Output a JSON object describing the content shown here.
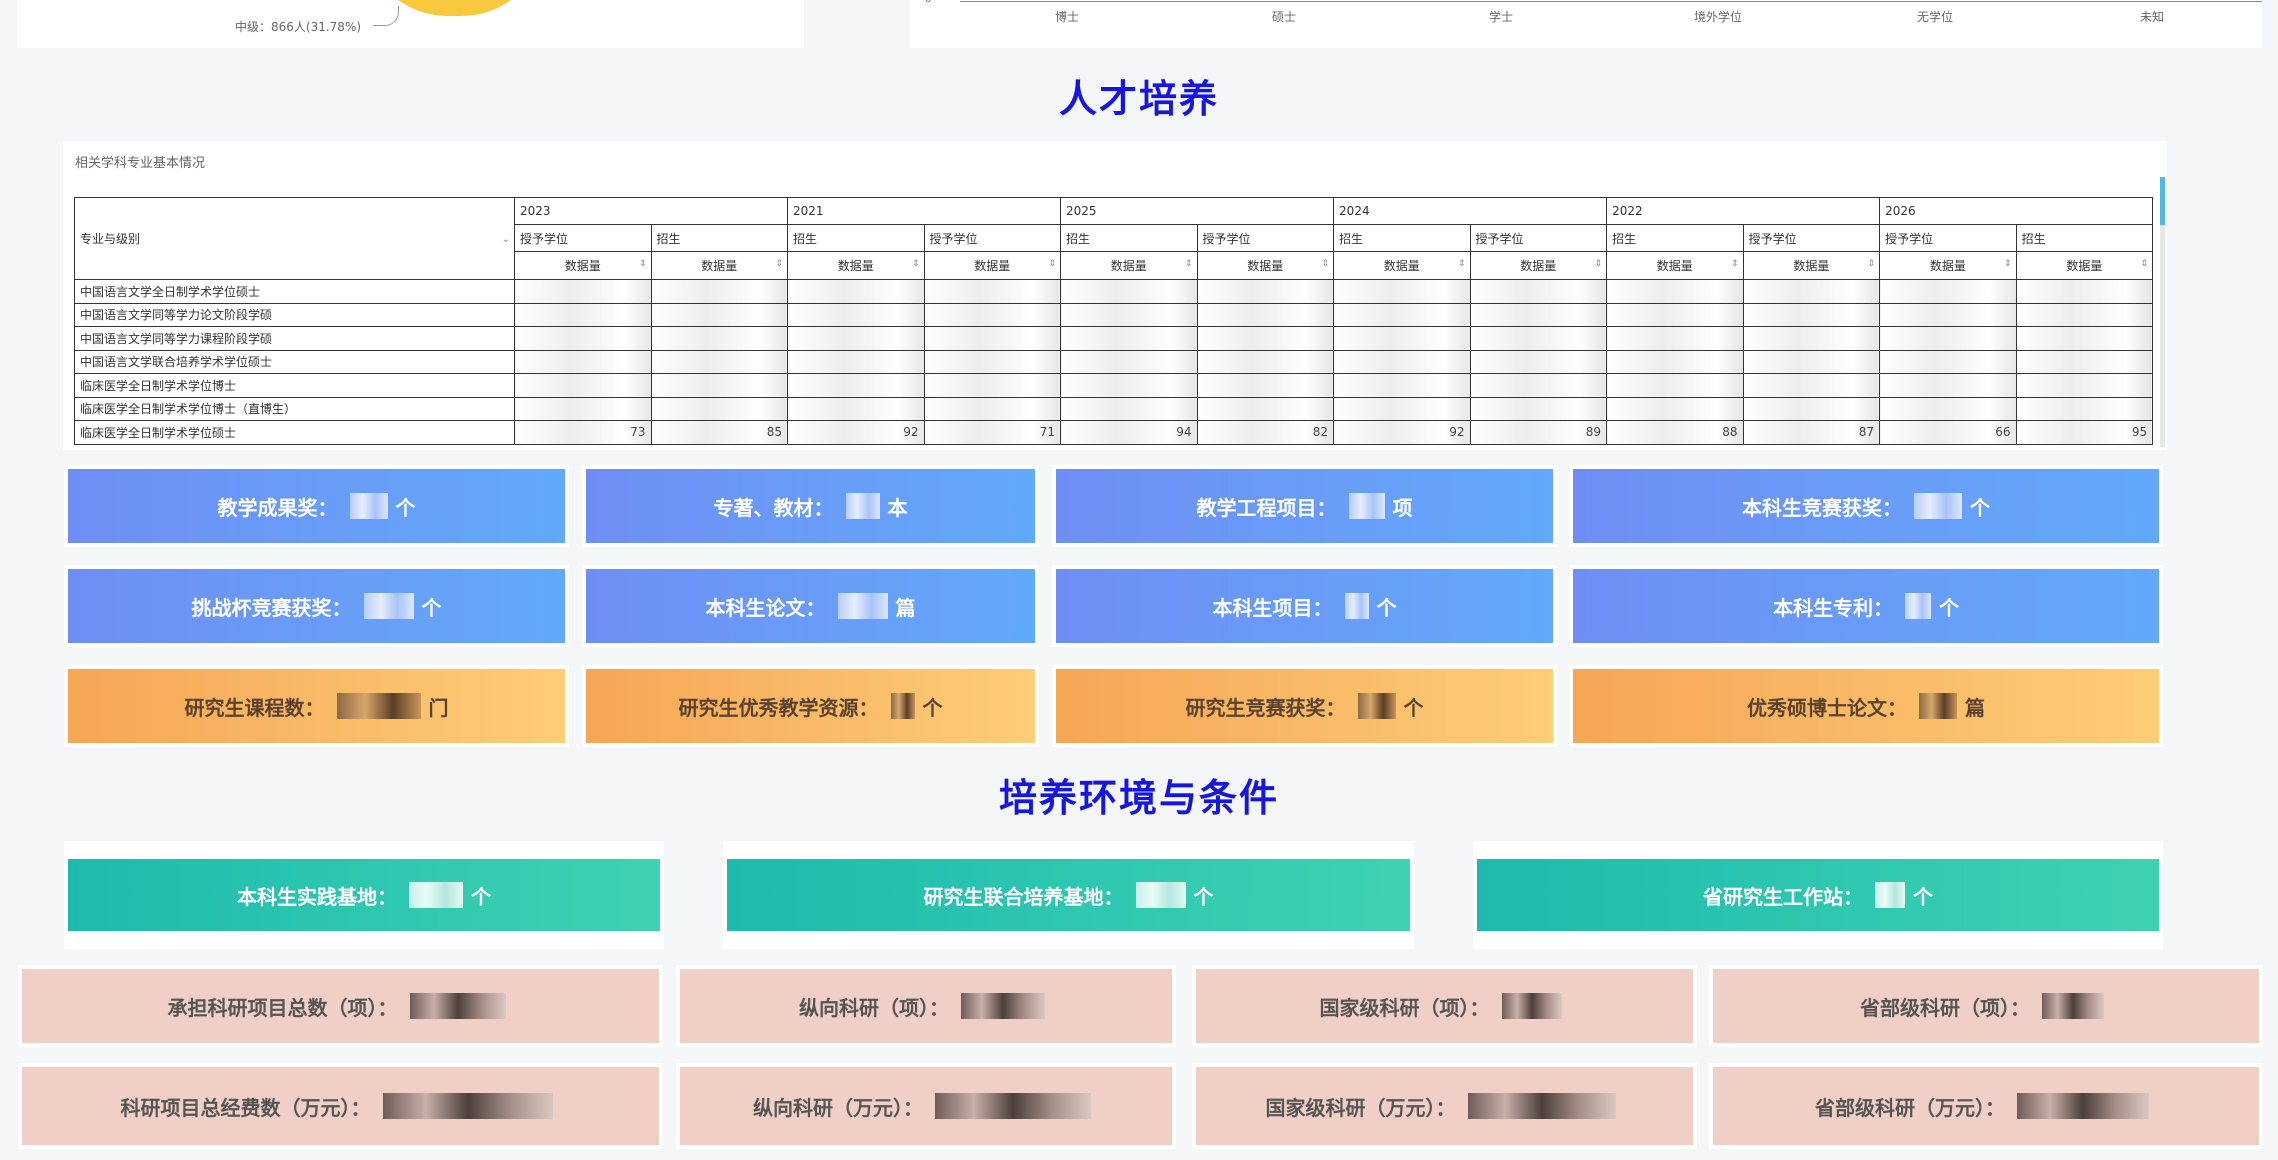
{
  "top_left": {
    "pie_label": "中级：866人(31.78%)"
  },
  "top_right": {
    "axis_zero": "0",
    "categories": [
      "博士",
      "硕士",
      "学士",
      "境外学位",
      "无学位",
      "未知"
    ]
  },
  "section_talent_title": "人才培养",
  "section_env_title": "培养环境与条件",
  "table": {
    "caption": "相关学科专业基本情况",
    "row_header": "专业与级别",
    "sort_icon": "⌄",
    "sort_arrows": "⇕",
    "years": [
      {
        "year": "2023",
        "subs": [
          "授予学位",
          "招生"
        ]
      },
      {
        "year": "2021",
        "subs": [
          "招生",
          "授予学位"
        ]
      },
      {
        "year": "2025",
        "subs": [
          "招生",
          "授予学位"
        ]
      },
      {
        "year": "2024",
        "subs": [
          "招生",
          "授予学位"
        ]
      },
      {
        "year": "2022",
        "subs": [
          "招生",
          "授予学位"
        ]
      },
      {
        "year": "2026",
        "subs": [
          "授予学位",
          "招生"
        ]
      }
    ],
    "quantity_label": "数据量",
    "rows": [
      {
        "name": "中国语言文学全日制学术学位硕士",
        "values": [
          "",
          "",
          "",
          "",
          "",
          "",
          "",
          "",
          "",
          "",
          "",
          ""
        ]
      },
      {
        "name": "中国语言文学同等学力论文阶段学硕",
        "values": [
          "",
          "",
          "",
          "",
          "",
          "",
          "",
          "",
          "",
          "",
          "",
          ""
        ]
      },
      {
        "name": "中国语言文学同等学力课程阶段学硕",
        "values": [
          "",
          "",
          "",
          "",
          "",
          "",
          "",
          "",
          "",
          "",
          "",
          ""
        ]
      },
      {
        "name": "中国语言文学联合培养学术学位硕士",
        "values": [
          "",
          "",
          "",
          "",
          "",
          "",
          "",
          "",
          "",
          "",
          "",
          ""
        ]
      },
      {
        "name": "临床医学全日制学术学位博士",
        "values": [
          "",
          "",
          "",
          "",
          "",
          "",
          "",
          "",
          "",
          "",
          "",
          ""
        ]
      },
      {
        "name": "临床医学全日制学术学位博士（直博生）",
        "values": [
          "",
          "",
          "",
          "",
          "",
          "",
          "",
          "",
          "",
          "",
          "",
          ""
        ]
      },
      {
        "name": "临床医学全日制学术学位硕士",
        "values": [
          "73",
          "85",
          "92",
          "71",
          "94",
          "82",
          "92",
          "89",
          "88",
          "87",
          "66",
          "95"
        ]
      }
    ]
  },
  "cards_blue_row1": [
    {
      "label": "教学成果奖：",
      "unit": "个"
    },
    {
      "label": "专著、教材：",
      "unit": "本"
    },
    {
      "label": "教学工程项目：",
      "unit": "项"
    },
    {
      "label": "本科生竞赛获奖：",
      "unit": "个"
    }
  ],
  "cards_blue_row2": [
    {
      "label": "挑战杯竞赛获奖：",
      "unit": "个"
    },
    {
      "label": "本科生论文：",
      "unit": "篇"
    },
    {
      "label": "本科生项目：",
      "unit": "个"
    },
    {
      "label": "本科生专利：",
      "unit": "个"
    }
  ],
  "cards_orange": [
    {
      "label": "研究生课程数：",
      "unit": "门"
    },
    {
      "label": "研究生优秀教学资源：",
      "unit": "个"
    },
    {
      "label": "研究生竞赛获奖：",
      "unit": "个"
    },
    {
      "label": "优秀硕博士论文：",
      "unit": "篇"
    }
  ],
  "cards_teal": [
    {
      "label": "本科生实践基地：",
      "unit": "个"
    },
    {
      "label": "研究生联合培养基地：",
      "unit": "个"
    },
    {
      "label": "省研究生工作站：",
      "unit": "个"
    }
  ],
  "cards_pink_row1": [
    {
      "label": "承担科研项目总数（项）："
    },
    {
      "label": "纵向科研（项）："
    },
    {
      "label": "国家级科研（项）："
    },
    {
      "label": "省部级科研（项）："
    }
  ],
  "cards_pink_row2": [
    {
      "label": "科研项目总经费数（万元）："
    },
    {
      "label": "纵向科研（万元）："
    },
    {
      "label": "国家级科研（万元）："
    },
    {
      "label": "省部级科研（万元）："
    }
  ]
}
